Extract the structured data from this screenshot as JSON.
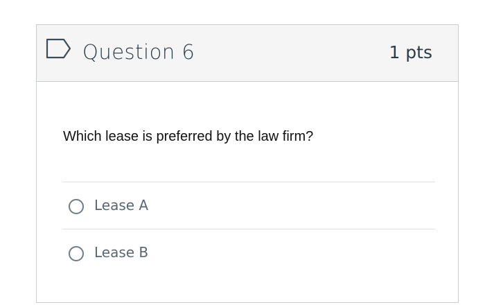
{
  "question": {
    "title": "Question 6",
    "points": "1 pts",
    "flag_icon": "flag-icon",
    "text": "Which lease is preferred by the law firm?"
  },
  "answers": [
    {
      "label": "Lease A",
      "selected": false
    },
    {
      "label": "Lease B",
      "selected": false
    }
  ],
  "colors": {
    "header_bg": "#f5f5f5",
    "border": "#c7cdd1",
    "title_text": "#2d3b45",
    "flag_stroke": "#3b4c5a"
  }
}
